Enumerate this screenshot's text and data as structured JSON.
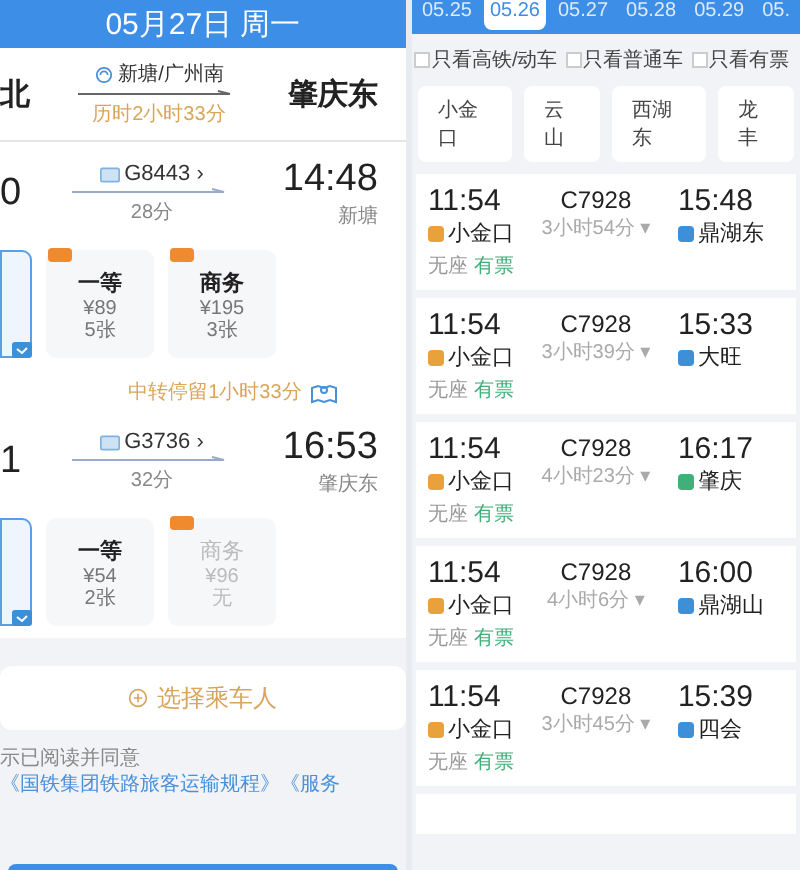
{
  "left": {
    "header": {
      "title": "05月27日 周一"
    },
    "route": {
      "from": "北",
      "via": "新塘/广州南",
      "total": "历时2小时33分",
      "to": "肇庆东"
    },
    "legs": [
      {
        "dep": "0",
        "train": "G8443 ›",
        "duration": "28分",
        "arr": "14:48",
        "arr_station": "新塘",
        "seats": [
          {
            "selected": true
          },
          {
            "selected": false,
            "disabled": false,
            "badge": true,
            "name": "一等",
            "price": "¥89",
            "count": "5张"
          },
          {
            "selected": false,
            "disabled": false,
            "badge": true,
            "name": "商务",
            "price": "¥195",
            "count": "3张"
          }
        ]
      },
      {
        "dep": "1",
        "train": "G3736 ›",
        "duration": "32分",
        "arr": "16:53",
        "arr_station": "肇庆东",
        "seats": [
          {
            "selected": true
          },
          {
            "selected": false,
            "disabled": false,
            "badge": false,
            "name": "一等",
            "price": "¥54",
            "count": "2张"
          },
          {
            "selected": false,
            "disabled": true,
            "badge": true,
            "name": "商务",
            "price": "¥96",
            "count": "无"
          }
        ]
      }
    ],
    "transfer": "中转停留1小时33分",
    "passenger_button": "选择乘车人",
    "agreement": {
      "text": "示已阅读并同意",
      "links": [
        "《国铁集团铁路旅客运输规程》",
        "《服务"
      ]
    }
  },
  "right": {
    "dates": [
      {
        "label": "05.25",
        "selected": false
      },
      {
        "label": "05.26",
        "selected": true
      },
      {
        "label": "05.27",
        "selected": false
      },
      {
        "label": "05.28",
        "selected": false
      },
      {
        "label": "05.29",
        "selected": false
      },
      {
        "label": "05.",
        "selected": false
      }
    ],
    "filters": [
      {
        "label": "只看高铁/动车",
        "checked": false
      },
      {
        "label": "只看普通车",
        "checked": false
      },
      {
        "label": "只看有票",
        "checked": false
      }
    ],
    "stations": [
      "小金口",
      "云山",
      "西湖东",
      "龙丰"
    ],
    "trains": [
      {
        "dep": "11:54",
        "train": "C7928",
        "arr": "15:48",
        "from": "小金口",
        "duration": "3小时54分 ▾",
        "to": "鼎湖东",
        "color": "#3d8fd8",
        "seat": "无座",
        "status": "有票"
      },
      {
        "dep": "11:54",
        "train": "C7928",
        "arr": "15:33",
        "from": "小金口",
        "duration": "3小时39分 ▾",
        "to": "大旺",
        "color": "#3d8fd8",
        "seat": "无座",
        "status": "有票"
      },
      {
        "dep": "11:54",
        "train": "C7928",
        "arr": "16:17",
        "from": "小金口",
        "duration": "4小时23分 ▾",
        "to": "肇庆",
        "color": "#3fb07a",
        "seat": "无座",
        "status": "有票"
      },
      {
        "dep": "11:54",
        "train": "C7928",
        "arr": "16:00",
        "from": "小金口",
        "duration": "4小时6分 ▾",
        "to": "鼎湖山",
        "color": "#3d8fd8",
        "seat": "无座",
        "status": "有票"
      },
      {
        "dep": "11:54",
        "train": "C7928",
        "arr": "15:39",
        "from": "小金口",
        "duration": "3小时45分 ▾",
        "to": "四会",
        "color": "#3d8fd8",
        "seat": "无座",
        "status": "有票"
      }
    ]
  }
}
